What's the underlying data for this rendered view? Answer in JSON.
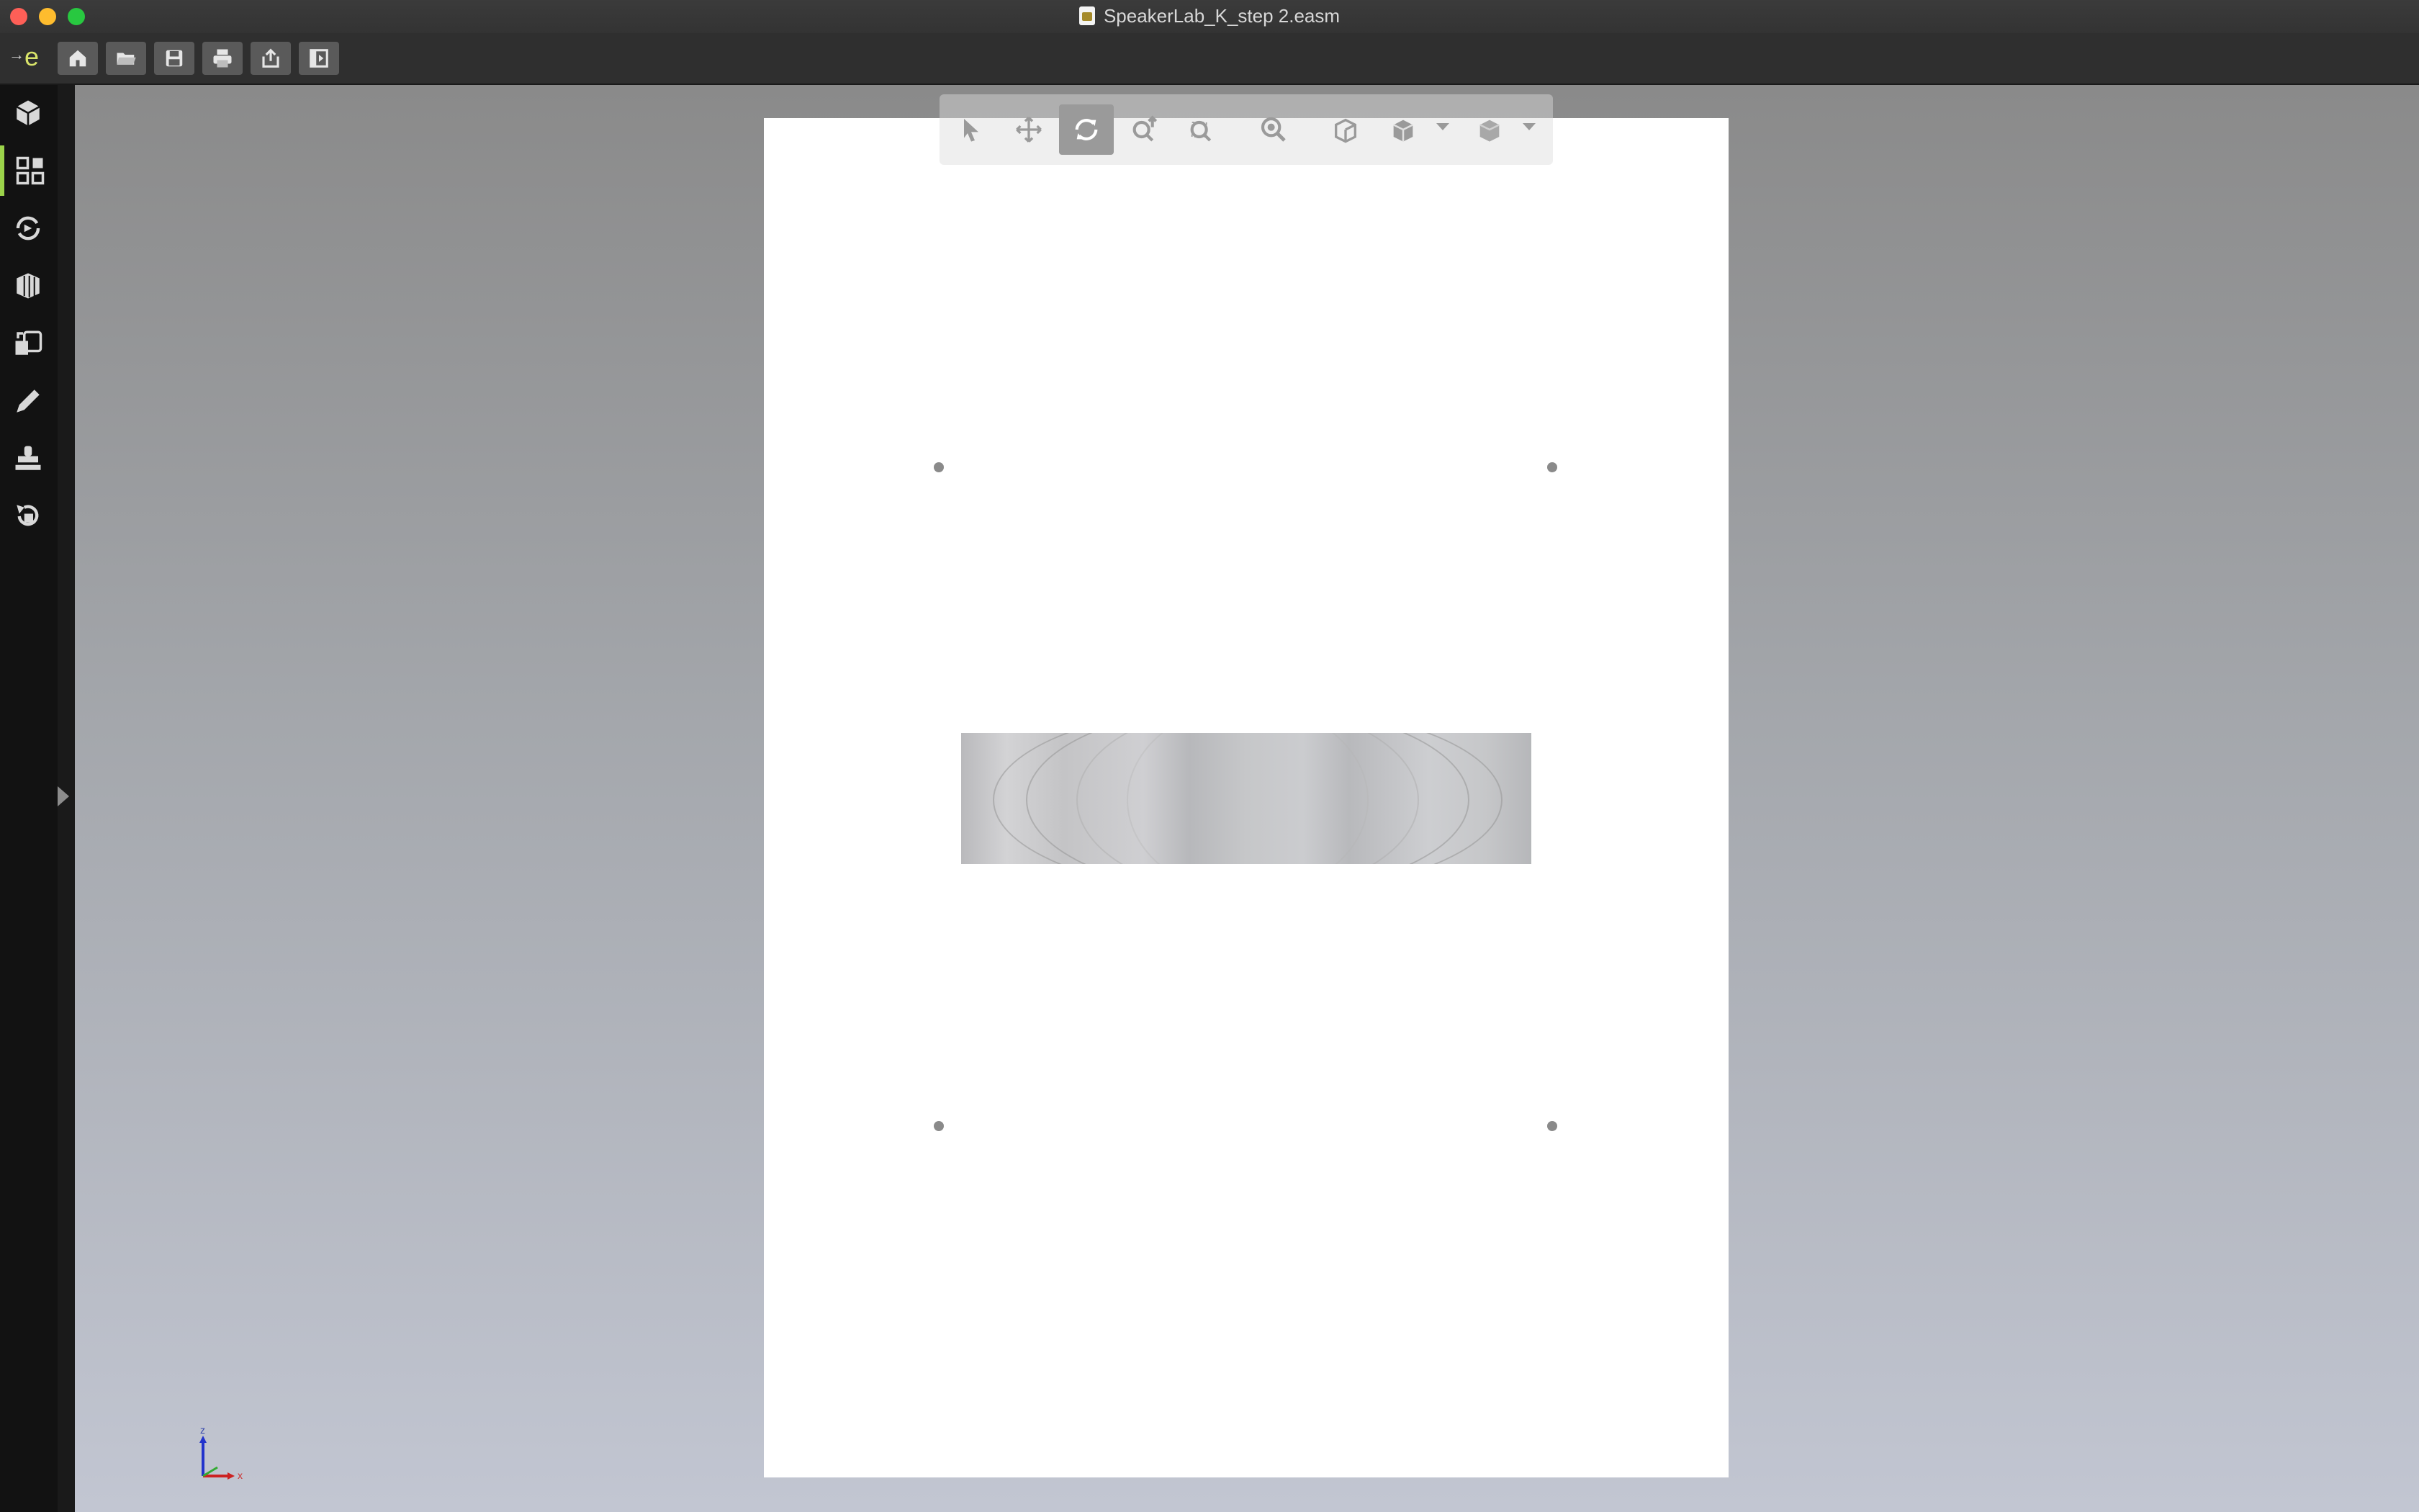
{
  "window": {
    "title": "SpeakerLab_K_step 2.easm"
  },
  "toolbar": {
    "logo": "e",
    "buttons": [
      {
        "name": "home-icon"
      },
      {
        "name": "open-folder-icon"
      },
      {
        "name": "save-icon"
      },
      {
        "name": "print-icon"
      },
      {
        "name": "share-icon"
      },
      {
        "name": "panel-toggle-icon"
      }
    ]
  },
  "sidebar": {
    "items": [
      {
        "name": "assembly-icon"
      },
      {
        "name": "dashboard-icon",
        "active": true
      },
      {
        "name": "animation-icon"
      },
      {
        "name": "cross-section-icon"
      },
      {
        "name": "mass-properties-icon"
      },
      {
        "name": "markup-pen-icon"
      },
      {
        "name": "stamp-icon"
      },
      {
        "name": "review-icon"
      }
    ]
  },
  "view_tools": {
    "items": [
      {
        "name": "select-icon"
      },
      {
        "name": "pan-icon"
      },
      {
        "name": "rotate-icon",
        "active": true
      },
      {
        "name": "zoom-icon"
      },
      {
        "name": "zoom-area-icon"
      },
      {
        "name": "zoom-fit-icon"
      },
      {
        "name": "standard-views-icon"
      },
      {
        "name": "display-style-icon"
      },
      {
        "name": "section-icon"
      }
    ]
  },
  "triad": {
    "z_label": "z",
    "x_label": "x"
  },
  "colors": {
    "accent": "#9bd34a",
    "title_text": "#d8d8d8"
  }
}
